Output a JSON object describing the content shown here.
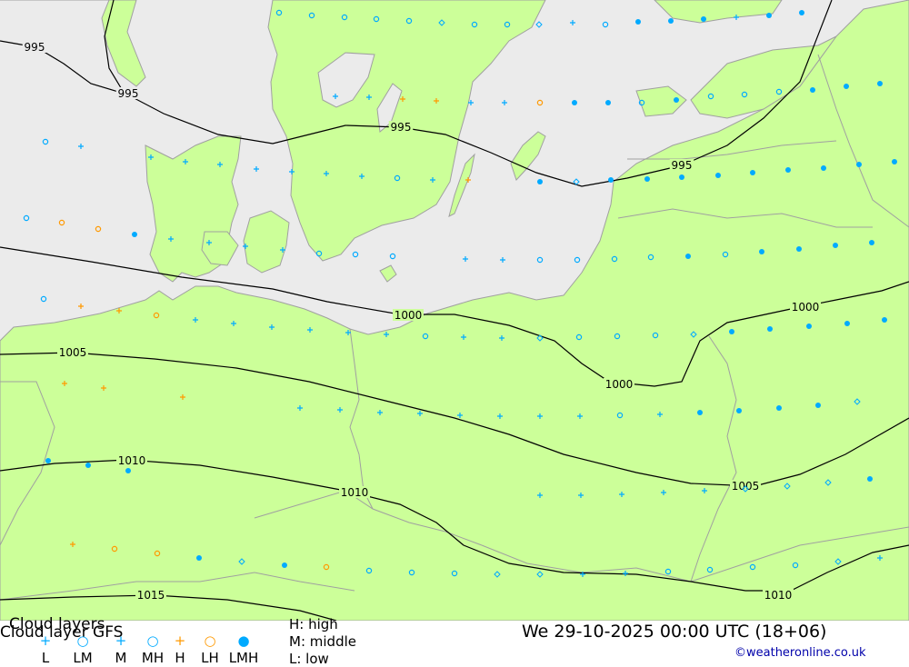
{
  "map": {
    "isobar_labels": [
      "995",
      "995",
      "995",
      "995",
      "1000",
      "1000",
      "1000",
      "1005",
      "1005",
      "1010",
      "1010",
      "1010",
      "1015"
    ],
    "colors": {
      "sea": "#ebebeb",
      "land": "#ccff99",
      "border": "#a0a0a0",
      "isobar": "#000000",
      "symbol_blue": "#00aaff",
      "symbol_orange": "#ff9900"
    },
    "symbol_kinds": {
      "plus_blue": "medium-level cloud (+)",
      "circle_blue": "middle-high cloud (o)",
      "dot_blue": "low-middle-high cloud (filled dot)",
      "diamond_blue": "cloud diamond marker",
      "plus_orange": "high cloud (+)",
      "circle_orange": "low-high cloud (o)"
    }
  },
  "footer": {
    "title_line1": "Cloud layers",
    "title_line2": "Cloud layer  GFS",
    "legend": [
      {
        "symbol": "+",
        "label": "L",
        "color": "#00aaff"
      },
      {
        "symbol": "○",
        "label": "LM",
        "color": "#00aaff"
      },
      {
        "symbol": "+",
        "label": "M",
        "color": "#00aaff"
      },
      {
        "symbol": "○",
        "label": "MH",
        "color": "#00aaff"
      },
      {
        "symbol": "+",
        "label": "H",
        "color": "#ff9900"
      },
      {
        "symbol": "○",
        "label": "LH",
        "color": "#ff9900"
      },
      {
        "symbol": "●",
        "label": "LMH",
        "color": "#00aaff"
      }
    ],
    "key_high": "H: high",
    "key_middle": "M: middle",
    "key_low": "L: low",
    "datetime": "We 29-10-2025 00:00 UTC (18+06)",
    "credit": "©weatheronline.co.uk"
  }
}
